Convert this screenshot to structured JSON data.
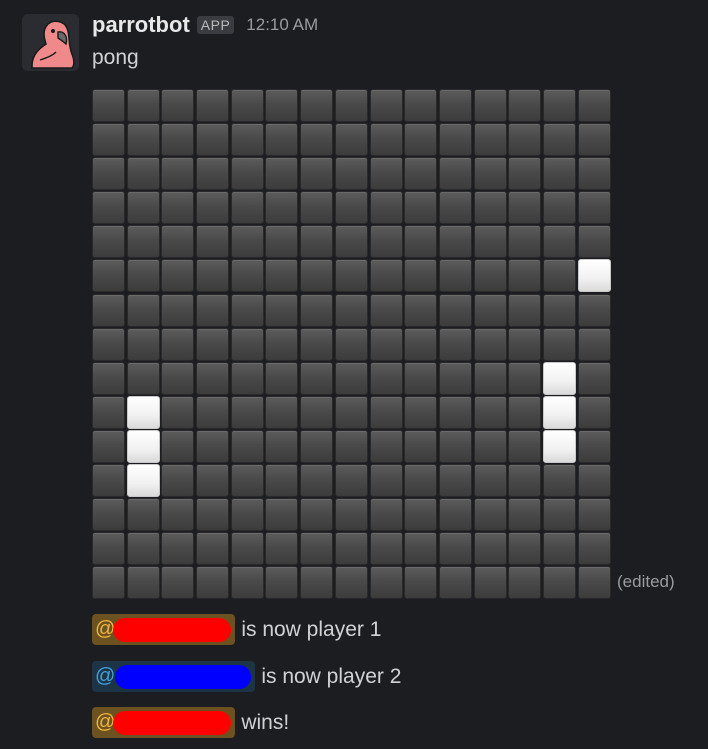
{
  "message": {
    "username": "parrotbot",
    "badge": "APP",
    "timestamp": "12:10 AM",
    "text": "pong",
    "edited_label": "(edited)"
  },
  "board": {
    "rows": 15,
    "cols": 15,
    "lit_cells": [
      [
        5,
        14
      ],
      [
        8,
        13
      ],
      [
        9,
        1
      ],
      [
        9,
        13
      ],
      [
        10,
        1
      ],
      [
        10,
        13
      ],
      [
        11,
        1
      ]
    ],
    "colors": {
      "empty": "#4a4a4a",
      "lit": "#f1f1f1"
    }
  },
  "events": [
    {
      "prefix": "@",
      "suffix": "is now player 1",
      "mention_color": "#6b5220",
      "redaction_color": "#ff0000"
    },
    {
      "prefix": "@",
      "suffix": "is now player 2",
      "mention_color": "#1d3446",
      "redaction_color": "#0000ff"
    },
    {
      "prefix": "@",
      "suffix": "wins!",
      "mention_color": "#6b5220",
      "redaction_color": "#ff0000"
    }
  ],
  "icons": {
    "avatar": "party-parrot-icon"
  }
}
